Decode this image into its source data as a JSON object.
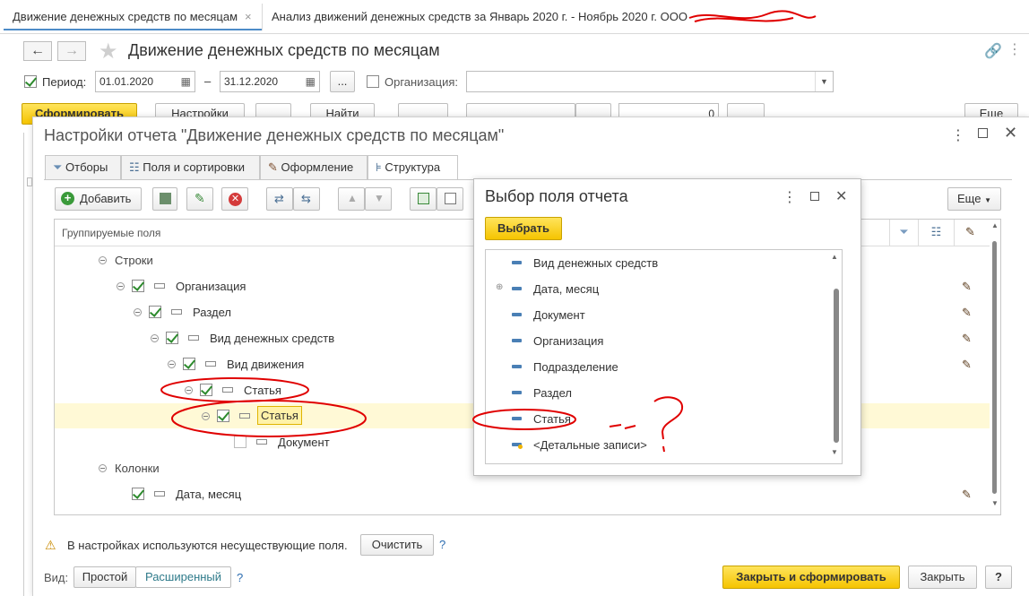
{
  "tabs": [
    {
      "label": "Движение денежных средств по месяцам"
    },
    {
      "label": "Анализ движений денежных средств за Январь 2020 г. - Ноябрь 2020 г. ООО"
    }
  ],
  "main": {
    "title": "Движение денежных средств по месяцам",
    "period_label": "Период:",
    "date_from": "01.01.2020",
    "date_to": "31.12.2020",
    "dash": "–",
    "ellipsis": "...",
    "org_label": "Организация:",
    "org_value": "",
    "generate": "Сформировать",
    "settings": "Настройки",
    "find": "Найти",
    "counter": "0",
    "more": "Еще"
  },
  "dialog": {
    "title": "Настройки отчета \"Движение денежных средств по месяцам\"",
    "tabs": [
      "Отборы",
      "Поля и сортировки",
      "Оформление",
      "Структура"
    ],
    "add": "Добавить",
    "more": "Еще",
    "header": "Группируемые поля",
    "tree": {
      "rows_label": "Строки",
      "org": "Организация",
      "section": "Раздел",
      "cash_type": "Вид денежных средств",
      "movement": "Вид движения",
      "article1": "Статья",
      "article2": "Статья",
      "document": "Документ",
      "columns_label": "Колонки",
      "date_month": "Дата, месяц"
    },
    "warning": "В настройках используются несуществующие поля.",
    "clear": "Очистить",
    "q": "?",
    "view_label": "Вид:",
    "view_simple": "Простой",
    "view_ext": "Расширенный",
    "close_generate": "Закрыть и сформировать",
    "close": "Закрыть"
  },
  "popup": {
    "title": "Выбор поля отчета",
    "select": "Выбрать",
    "items": [
      "Вид денежных средств",
      "Дата, месяц",
      "Документ",
      "Организация",
      "Подразделение",
      "Раздел",
      "Статья",
      "<Детальные записи>"
    ]
  },
  "colors": {
    "accent_yellow": "#f5c400",
    "check_green": "#2e8b2e",
    "annotation_red": "#e00000",
    "selected_row": "#fff9d6"
  }
}
